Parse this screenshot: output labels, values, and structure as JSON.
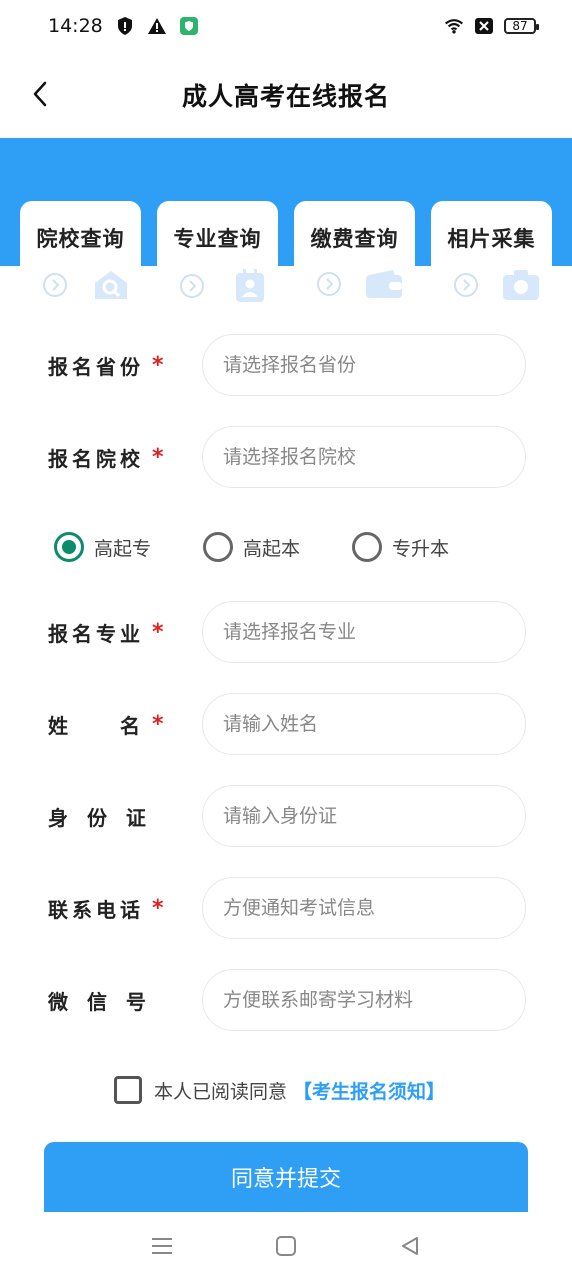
{
  "status_bar": {
    "time": "14:28",
    "icons": [
      "shield-icon",
      "warning-icon",
      "app-shield-icon",
      "wifi-icon",
      "close-box-icon"
    ],
    "battery": "87"
  },
  "nav": {
    "back_icon": "chevron-left-icon",
    "title": "成人高考在线报名"
  },
  "colors": {
    "primary": "#2f9ff5",
    "radio_checked": "#0d8b6d",
    "required": "#e02020"
  },
  "tabs": [
    {
      "label": "院校查询",
      "icon": "school-search-icon"
    },
    {
      "label": "专业查询",
      "icon": "id-badge-icon"
    },
    {
      "label": "缴费查询",
      "icon": "wallet-icon"
    },
    {
      "label": "相片采集",
      "icon": "camera-icon"
    }
  ],
  "form": {
    "province": {
      "label": "报名省份",
      "required": "*",
      "placeholder": "请选择报名省份"
    },
    "school": {
      "label": "报名院校",
      "required": "*",
      "placeholder": "请选择报名院校"
    },
    "level_options": [
      {
        "label": "高起专",
        "checked": true
      },
      {
        "label": "高起本",
        "checked": false
      },
      {
        "label": "专升本",
        "checked": false
      }
    ],
    "major": {
      "label": "报名专业",
      "required": "*",
      "placeholder": "请选择报名专业"
    },
    "name": {
      "label": "姓　　名",
      "required": "*",
      "placeholder": "请输入姓名"
    },
    "id_card": {
      "label": "身 份 证",
      "placeholder": "请输入身份证"
    },
    "phone": {
      "label": "联系电话",
      "required": "*",
      "placeholder": "方便通知考试信息"
    },
    "wechat": {
      "label": "微 信 号",
      "placeholder": "方便联系邮寄学习材料"
    }
  },
  "agreement": {
    "text": "本人已阅读同意",
    "link": "【考生报名须知】"
  },
  "submit_label": "同意并提交"
}
